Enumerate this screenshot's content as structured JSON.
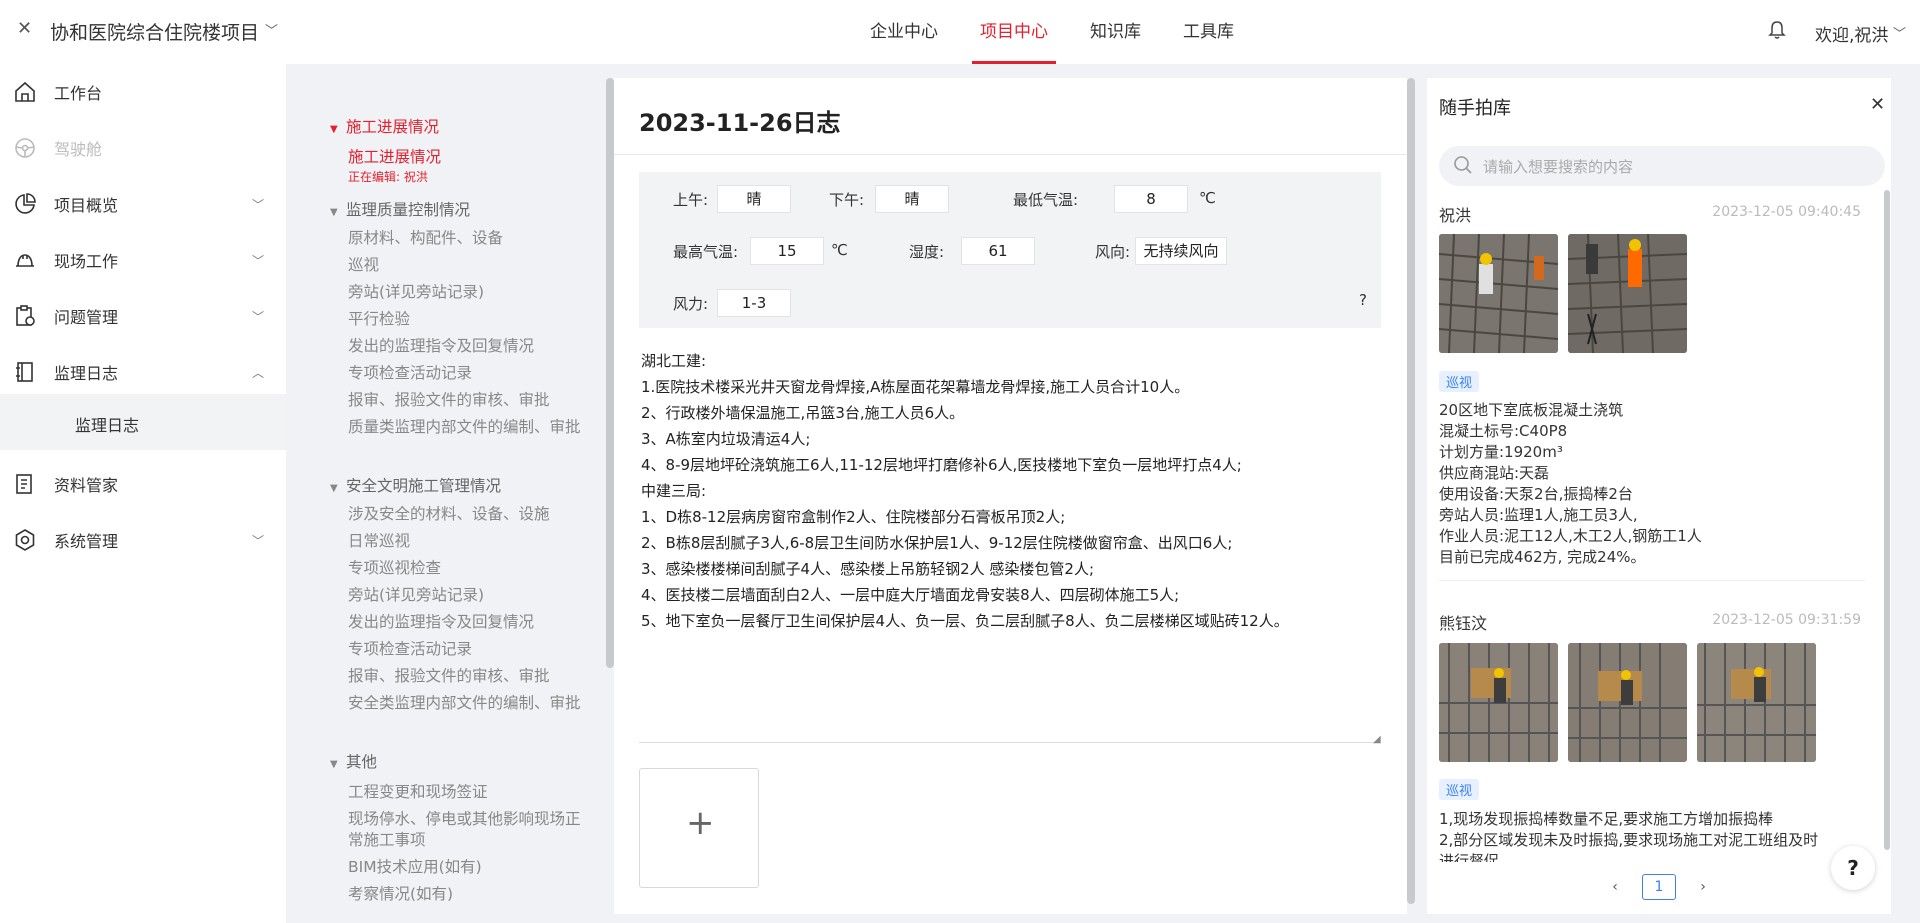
{
  "header": {
    "project_name": "协和医院综合住院楼项目",
    "nav": [
      "企业中心",
      "项目中心",
      "知识库",
      "工具库"
    ],
    "active_nav": "项目中心",
    "welcome": "欢迎,祝洪"
  },
  "sidebar": {
    "items": [
      {
        "label": "工作台",
        "icon": "home-icon"
      },
      {
        "label": "驾驶舱",
        "icon": "steering-wheel-icon",
        "disabled": true
      },
      {
        "label": "项目概览",
        "icon": "pie-chart-icon"
      },
      {
        "label": "现场工作",
        "icon": "hard-hat-icon"
      },
      {
        "label": "问题管理",
        "icon": "clipboard-icon"
      },
      {
        "label": "监理日志",
        "icon": "log-book-icon",
        "expanded": true
      },
      {
        "label": "资料管家",
        "icon": "document-icon"
      },
      {
        "label": "系统管理",
        "icon": "settings-icon"
      }
    ],
    "sub_item": "监理日志"
  },
  "tree": {
    "groups": [
      {
        "label": "施工进展情况",
        "active": true
      },
      {
        "label": "监理质量控制情况"
      },
      {
        "label": "安全文明施工管理情况"
      },
      {
        "label": "其他"
      }
    ],
    "active_leaf": "施工进展情况",
    "editing_note": "正在编辑: 祝洪",
    "quality_leaves": [
      "原材料、构配件、设备",
      "巡视",
      "旁站(详见旁站记录)",
      "平行检验",
      "发出的监理指令及回复情况",
      "专项检查活动记录",
      "报审、报验文件的审核、审批",
      "质量类监理内部文件的编制、审批"
    ],
    "safety_leaves": [
      "涉及安全的材料、设备、设施",
      "日常巡视",
      "专项巡视检查",
      "旁站(详见旁站记录)",
      "发出的监理指令及回复情况",
      "专项检查活动记录",
      "报审、报验文件的审核、审批",
      "安全类监理内部文件的编制、审批"
    ],
    "other_leaves": [
      "工程变更和现场签证",
      "现场停水、停电或其他影响现场正常施工事项",
      "BIM技术应用(如有)",
      "考察情况(如有)"
    ]
  },
  "doc": {
    "title": "2023-11-26日志",
    "weather": {
      "am_label": "上午:",
      "am": "晴",
      "pm_label": "下午:",
      "pm": "晴",
      "min_temp_label": "最低气温:",
      "min_temp": "8",
      "max_temp_label": "最高气温:",
      "max_temp": "15",
      "humidity_label": "湿度:",
      "humidity": "61",
      "wind_dir_label": "风向:",
      "wind_dir": "无持续风向",
      "wind_force_label": "风力:",
      "wind_force": "1-3",
      "unit_c": "℃",
      "help": "?"
    },
    "lines": [
      "湖北工建:",
      "1.医院技术楼采光井天窗龙骨焊接,A栋屋面花架幕墙龙骨焊接,施工人员合计10人。",
      "2、行政楼外墙保温施工,吊篮3台,施工人员6人。",
      "3、A栋室内垃圾清运4人;",
      "4、8-9层地坪砼浇筑施工6人,11-12层地坪打磨修补6人,医技楼地下室负一层地坪打点4人;",
      "中建三局:",
      "1、D栋8-12层病房窗帘盒制作2人、住院楼部分石膏板吊顶2人;",
      "2、B栋8层刮腻子3人,6-8层卫生间防水保护层1人、9-12层住院楼做窗帘盒、出风口6人;",
      "3、感染楼楼梯间刮腻子4人、感染楼上吊筋轻钢2人 感染楼包管2人;",
      "4、医技楼二层墙面刮白2人、一层中庭大厅墙面龙骨安装8人、四层砌体施工5人;",
      "5、地下室负一层餐厅卫生间保护层4人、负一层、负二层刮腻子8人、负二层楼梯区域贴砖12人。"
    ],
    "upload_symbol": "+"
  },
  "photo_lib": {
    "title": "随手拍库",
    "search_placeholder": "请输入想要搜索的内容",
    "posts": [
      {
        "author": "祝洪",
        "time": "2023-12-05 09:40:45",
        "tag": "巡视",
        "photos": 2,
        "lines": [
          " 20区地下室底板混凝土浇筑",
          "混凝土标号:C40P8",
          "计划方量:1920m³",
          "供应商混站:天磊",
          "使用设备:天泵2台,振捣棒2台",
          "旁站人员:监理1人,施工员3人,",
          "作业人员:泥工12人,木工2人,钢筋工1人",
          "目前已完成462方, 完成24%。"
        ]
      },
      {
        "author": "熊钰汶",
        "time": "2023-12-05 09:31:59",
        "tag": "巡视",
        "photos": 3,
        "lines": [
          " 1,现场发现振捣棒数量不足,要求施工方增加振捣棒",
          "2,部分区域发现未及时振捣,要求现场施工对泥工班组及时",
          "进行督促"
        ]
      }
    ],
    "pager": {
      "page": "1",
      "prev": "‹",
      "next": "›"
    },
    "help": "?"
  }
}
